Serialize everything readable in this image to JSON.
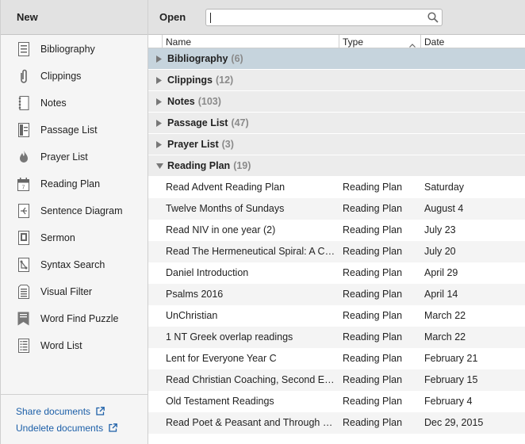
{
  "left": {
    "header": "New",
    "items": [
      {
        "label": "Bibliography",
        "icon": "bibliography-icon"
      },
      {
        "label": "Clippings",
        "icon": "paperclip-icon"
      },
      {
        "label": "Notes",
        "icon": "notes-icon"
      },
      {
        "label": "Passage List",
        "icon": "passage-list-icon"
      },
      {
        "label": "Prayer List",
        "icon": "flame-icon"
      },
      {
        "label": "Reading Plan",
        "icon": "calendar-icon"
      },
      {
        "label": "Sentence Diagram",
        "icon": "sentence-diagram-icon"
      },
      {
        "label": "Sermon",
        "icon": "sermon-icon"
      },
      {
        "label": "Syntax Search",
        "icon": "syntax-search-icon"
      },
      {
        "label": "Visual Filter",
        "icon": "visual-filter-icon"
      },
      {
        "label": "Word Find Puzzle",
        "icon": "word-find-icon"
      },
      {
        "label": "Word List",
        "icon": "word-list-icon"
      }
    ],
    "footer": {
      "share": "Share documents",
      "undelete": "Undelete documents"
    }
  },
  "right": {
    "header": "Open",
    "search": {
      "value": "",
      "placeholder": ""
    },
    "columns": {
      "name": "Name",
      "type": "Type",
      "date": "Date"
    },
    "groups": [
      {
        "name": "Bibliography",
        "count": "(6)",
        "expanded": false,
        "selected": true
      },
      {
        "name": "Clippings",
        "count": "(12)",
        "expanded": false,
        "selected": false
      },
      {
        "name": "Notes",
        "count": "(103)",
        "expanded": false,
        "selected": false
      },
      {
        "name": "Passage List",
        "count": "(47)",
        "expanded": false,
        "selected": false
      },
      {
        "name": "Prayer List",
        "count": "(3)",
        "expanded": false,
        "selected": false
      },
      {
        "name": "Reading Plan",
        "count": "(19)",
        "expanded": true,
        "selected": false
      }
    ],
    "documents": [
      {
        "name": "Read Advent Reading Plan",
        "type": "Reading Plan",
        "date": "Saturday"
      },
      {
        "name": "Twelve Months of Sundays",
        "type": "Reading Plan",
        "date": "August 4"
      },
      {
        "name": "Read NIV in one year (2)",
        "type": "Reading Plan",
        "date": "July 23"
      },
      {
        "name": "Read The Hermeneutical Spiral: A Co...",
        "type": "Reading Plan",
        "date": "July 20"
      },
      {
        "name": "Daniel Introduction",
        "type": "Reading Plan",
        "date": "April 29"
      },
      {
        "name": "Psalms 2016",
        "type": "Reading Plan",
        "date": "April 14"
      },
      {
        "name": "UnChristian",
        "type": "Reading Plan",
        "date": "March 22"
      },
      {
        "name": "1 NT Greek overlap readings",
        "type": "Reading Plan",
        "date": "March 22"
      },
      {
        "name": "Lent for Everyone Year C",
        "type": "Reading Plan",
        "date": "February 21"
      },
      {
        "name": "Read Christian Coaching, Second Edit...",
        "type": "Reading Plan",
        "date": "February 15"
      },
      {
        "name": "Old Testament Readings",
        "type": "Reading Plan",
        "date": "February 4"
      },
      {
        "name": "Read Poet & Peasant and Through Pe...",
        "type": "Reading Plan",
        "date": "Dec 29, 2015"
      }
    ]
  }
}
